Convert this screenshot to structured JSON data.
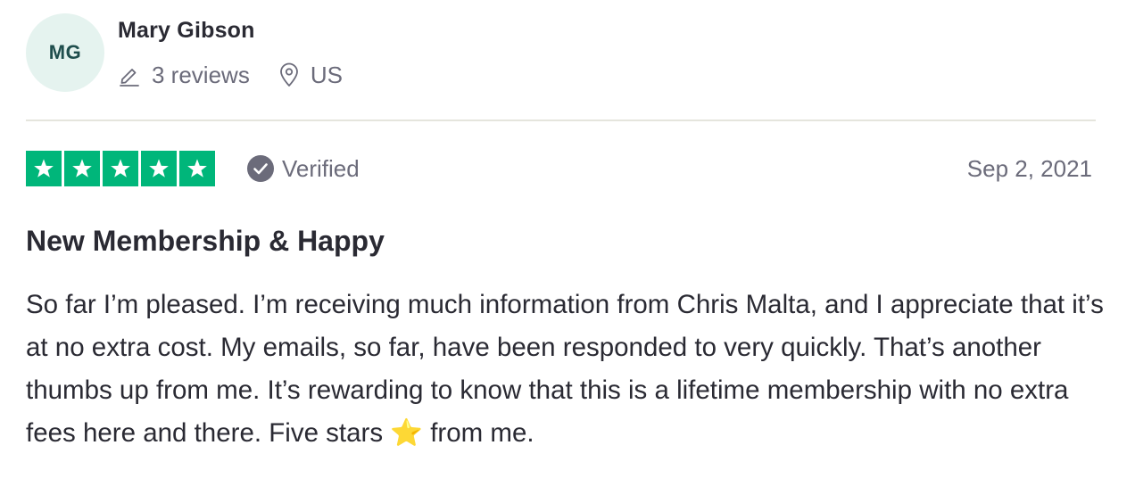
{
  "reviewer": {
    "initials": "MG",
    "name": "Mary Gibson",
    "reviews_count": "3 reviews",
    "country": "US",
    "icons": {
      "reviews": "pencil-icon",
      "location": "location-pin-icon"
    }
  },
  "review": {
    "rating": 5,
    "rating_max": 5,
    "star_color": "#00b67a",
    "verified_label": "Verified",
    "verified_icon": "check-circle-icon",
    "date": "Sep 2, 2021",
    "title": "New Membership & Happy",
    "body": "So far I’m pleased. I’m receiving much information from Chris Malta, and I appreciate that it’s at no extra cost. My emails, so far, have been responded to very quickly. That’s another thumbs up from me. It’s rewarding to know that this is a lifetime membership with no extra fees here and there. Five stars ⭐ from me."
  }
}
